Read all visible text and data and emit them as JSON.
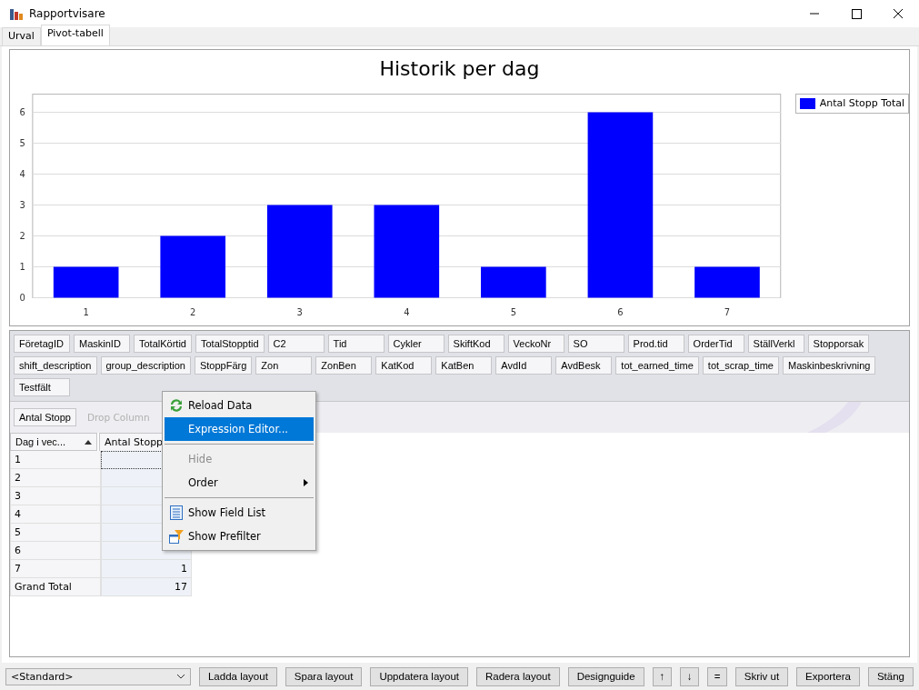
{
  "window": {
    "title": "Rapportvisare"
  },
  "tabs": [
    {
      "label": "Urval",
      "selected": false
    },
    {
      "label": "Pivot-tabell",
      "selected": true
    }
  ],
  "chart": {
    "chart_data": {
      "type": "bar",
      "title": "Historik per dag",
      "categories": [
        "1",
        "2",
        "3",
        "4",
        "5",
        "6",
        "7"
      ],
      "series": [
        {
          "name": "Antal Stopp Total",
          "color": "#0000ff",
          "values": [
            1,
            2,
            3,
            3,
            1,
            6,
            1
          ]
        }
      ],
      "ylim": [
        0,
        6
      ],
      "grid": true,
      "yticks": [
        0,
        1,
        2,
        3,
        4,
        5,
        6
      ]
    }
  },
  "field_list": [
    "FöretagID",
    "MaskinID",
    "TotalKörtid",
    "TotalStopptid",
    "C2",
    "Tid",
    "Cykler",
    "SkiftKod",
    "VeckoNr",
    "SO",
    "Prod.tid",
    "OrderTid",
    "StällVerkl",
    "Stopporsak",
    "shift_description",
    "group_description",
    "StoppFärg",
    "Zon",
    "ZonBen",
    "KatKod",
    "KatBen",
    "AvdId",
    "AvdBesk",
    "tot_earned_time",
    "tot_scrap_time",
    "Maskinbeskrivning",
    "Testfält"
  ],
  "data_fields": [
    "Antal Stopp"
  ],
  "column_drop_hint": "Drop Column",
  "pivot": {
    "row_header": "Dag i vec...",
    "column_header": "Antal Stopp",
    "rows": [
      {
        "label": "1",
        "value": ""
      },
      {
        "label": "2",
        "value": ""
      },
      {
        "label": "3",
        "value": ""
      },
      {
        "label": "4",
        "value": ""
      },
      {
        "label": "5",
        "value": ""
      },
      {
        "label": "6",
        "value": ""
      },
      {
        "label": "7",
        "value": "1"
      },
      {
        "label": "Grand Total",
        "value": "17"
      }
    ]
  },
  "context_menu": [
    {
      "kind": "reload",
      "label": "Reload Data",
      "selected": false,
      "disabled": false,
      "submenu": false
    },
    {
      "kind": "plain",
      "label": "Expression Editor...",
      "selected": true,
      "disabled": false,
      "submenu": false
    },
    {
      "kind": "separator"
    },
    {
      "kind": "plain",
      "label": "Hide",
      "selected": false,
      "disabled": true,
      "submenu": false
    },
    {
      "kind": "plain",
      "label": "Order",
      "selected": false,
      "disabled": false,
      "submenu": true
    },
    {
      "kind": "separator"
    },
    {
      "kind": "list",
      "label": "Show Field List",
      "selected": false,
      "disabled": false,
      "submenu": false
    },
    {
      "kind": "filter",
      "label": "Show Prefilter",
      "selected": false,
      "disabled": false,
      "submenu": false
    }
  ],
  "layout_select": {
    "value": "<Standard>"
  },
  "buttons": [
    "Ladda layout",
    "Spara layout",
    "Uppdatera layout",
    "Radera layout",
    "Designguide",
    "↑",
    "↓",
    "=",
    "Skriv ut",
    "Exportera",
    "Stäng"
  ]
}
